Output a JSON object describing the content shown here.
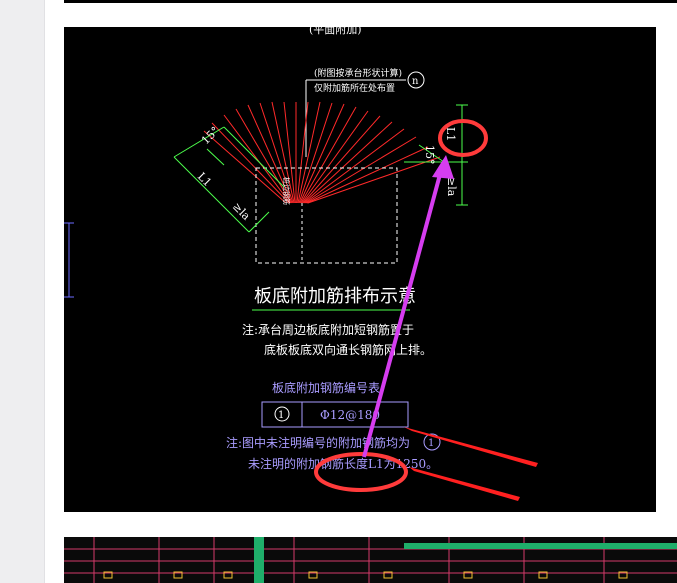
{
  "drawing": {
    "top_cut_label": "(平面附加)",
    "callout_line1": "(附图按承台形状计算)",
    "callout_line2": "仅附加筋所在处布置",
    "callout_number": "n",
    "dim_l1_right": "L1",
    "dim_l1_left": "L1",
    "dim_angle_left": "15°",
    "dim_angle_right": "15°",
    "dim_la_right": "≥la",
    "dim_la_left": "≥la",
    "side_mark_left": "桩边钢筋",
    "title": "板底附加筋排布示意",
    "note_line1": "注:承台周边板底附加短钢筋置于",
    "note_line2": "底板板底双向通长钢筋网上排。",
    "table_title": "板底附加钢筋编号表",
    "table_row_number": "1",
    "table_row_spec": "Φ12@180",
    "note2_line1": "注:图中未注明编号的附加钢筋均为",
    "note2_line2": "未注明的附加钢筋长度L1为1250。",
    "side_marker_number": "1"
  },
  "annotation_colors": {
    "circle": "#ff3b3b",
    "arrow_magenta": "#d63df0",
    "arrow_red": "#ff2020"
  }
}
